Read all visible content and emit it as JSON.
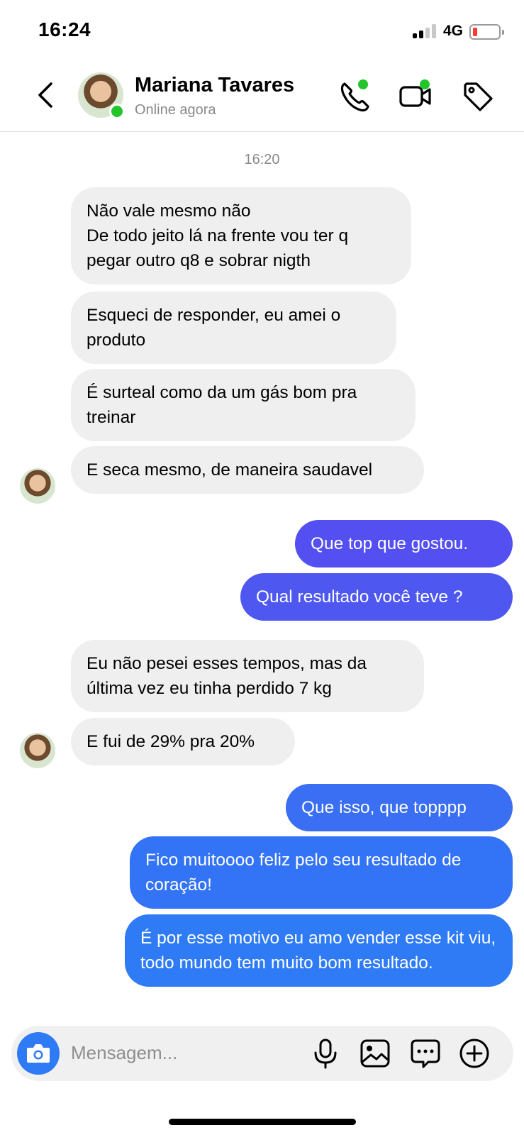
{
  "status_bar": {
    "time": "16:24",
    "network": "4G"
  },
  "header": {
    "contact_name": "Mariana Tavares",
    "contact_status": "Online agora",
    "icons": [
      "back-icon",
      "phone-icon",
      "video-icon",
      "tag-icon"
    ]
  },
  "chat": {
    "timestamp": "16:20",
    "messages": [
      {
        "direction": "in",
        "text": "Não vale mesmo não\nDe todo jeito lá na frente vou ter q pegar outro q8 e sobrar nigth"
      },
      {
        "direction": "in",
        "text": "Esqueci de responder, eu amei o produto"
      },
      {
        "direction": "in",
        "text": "É surteal como da um gás bom pra treinar"
      },
      {
        "direction": "in",
        "text": "E seca mesmo, de maneira saudavel"
      },
      {
        "direction": "out",
        "text": "Que top que gostou."
      },
      {
        "direction": "out",
        "text": "Qual resultado você teve ?"
      },
      {
        "direction": "in",
        "text": "Eu não pesei esses tempos, mas da última vez eu tinha perdido 7 kg"
      },
      {
        "direction": "in",
        "text": "E fui de 29% pra 20%"
      },
      {
        "direction": "out",
        "text": "Que isso, que topppp"
      },
      {
        "direction": "out",
        "text": "Fico muitoooo feliz pelo seu resultado de coração!"
      },
      {
        "direction": "out",
        "text": "É por esse motivo eu amo vender esse kit viu, todo mundo tem muito bom resultado."
      }
    ]
  },
  "composer": {
    "placeholder": "Mensagem...",
    "icons": [
      "camera-icon",
      "microphone-icon",
      "gallery-icon",
      "sticker-chat-icon",
      "plus-icon"
    ]
  },
  "colors": {
    "incoming_bubble": "#efefef",
    "outgoing_gradient_top": "#5a52f0",
    "outgoing_gradient_bottom": "#2f7bf6",
    "online": "#22c52a",
    "battery_low": "#ff3b30"
  }
}
